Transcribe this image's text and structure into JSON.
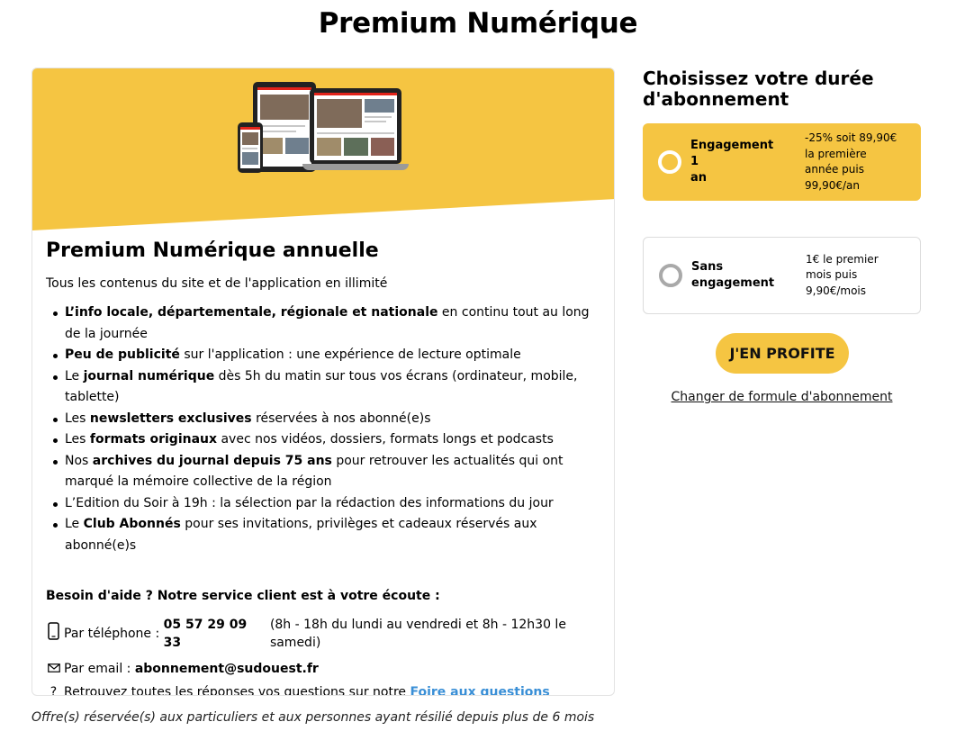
{
  "page": {
    "title": "Premium Numérique"
  },
  "offer_card": {
    "title": "Premium Numérique annuelle",
    "subtitle": "Tous les contenus du site et de l'application en illimité",
    "features": [
      {
        "bold": "L’info locale, départementale, régionale et nationale",
        "after": " en continu tout au long de la journée"
      },
      {
        "bold": "Peu de publicité",
        "after": " sur l'application : une expérience de lecture optimale"
      },
      {
        "before": "Le ",
        "bold": "journal numérique",
        "after": " dès 5h du matin sur tous vos écrans (ordinateur, mobile, tablette)"
      },
      {
        "before": "Les ",
        "bold": "newsletters exclusives",
        "after": " réservées à nos abonné(e)s"
      },
      {
        "before": "Les ",
        "bold": "formats originaux",
        "after": " avec nos vidéos, dossiers, formats longs et podcasts"
      },
      {
        "before": "Nos ",
        "bold": "archives du journal depuis 75 ans",
        "after": " pour retrouver les actualités qui ont marqué la mémoire collective de la région"
      },
      {
        "before": "L’Edition du Soir à 19h : la sélection par la rédaction des informations du jour"
      },
      {
        "before": "Le ",
        "bold": "Club Abonnés",
        "after": " pour ses invitations, privilèges et cadeaux réservés aux abonné(e)s"
      }
    ],
    "help": {
      "title": "Besoin d'aide ? Notre service client est à votre écoute :",
      "phone_prefix": "Par téléphone : ",
      "phone_number": "05 57 29 09 33",
      "phone_hours": "(8h - 18h du lundi au vendredi et 8h - 12h30 le samedi)",
      "email_prefix": "Par email : ",
      "email": "abonnement@sudouest.fr",
      "faq_prefix": "Retrouvez toutes les réponses vos questions sur notre ",
      "faq_link": "Foire aux questions"
    }
  },
  "footnote": "Offre(s) réservée(s) aux particuliers et aux personnes ayant résilié depuis plus de 6 mois",
  "sidebar": {
    "title_line1": "Choisissez votre durée",
    "title_line2": "d'abonnement",
    "options": [
      {
        "label_line1": "Engagement 1",
        "label_line2": "an",
        "desc": [
          "-25% soit 89,90€",
          "la première",
          "année puis",
          "99,90€/an"
        ]
      },
      {
        "label_line1": "Sans",
        "label_line2": "engagement",
        "desc": [
          "1€ le premier",
          "mois puis",
          "9,90€/mois"
        ]
      }
    ],
    "cta_label": "J'EN PROFITE",
    "change_link": "Changer de formule d'abonnement"
  },
  "colors": {
    "accent_yellow": "#f5c542",
    "link_blue": "#3a8fd6",
    "brand_red": "#e2231a"
  },
  "icons": [
    "devices-illustration",
    "phone-icon",
    "email-icon",
    "question-icon"
  ]
}
